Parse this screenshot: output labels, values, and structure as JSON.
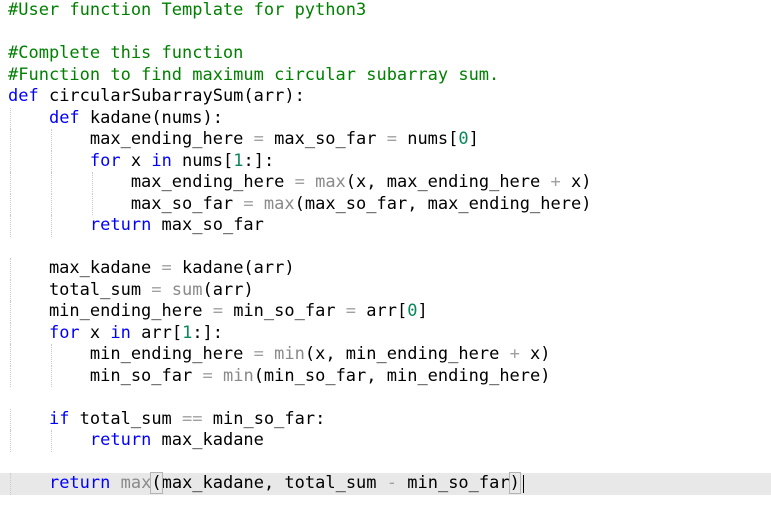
{
  "editor": {
    "language": "python3",
    "colors": {
      "comment": "#008000",
      "keyword": "#0000ff",
      "builtin": "#8a8a8a",
      "number": "#09885a",
      "operator": "#a0a0a0",
      "text": "#000000",
      "active_line": "#e8e8e8"
    },
    "lines": [
      [
        [
          "comment",
          "#User function Template for python3"
        ]
      ],
      [],
      [
        [
          "comment",
          "#Complete this function"
        ]
      ],
      [
        [
          "comment",
          "#Function to find maximum circular subarray sum."
        ]
      ],
      [
        [
          "kw",
          "def"
        ],
        [
          "name",
          " circularSubarraySum(arr):"
        ]
      ],
      [
        [
          "name",
          "    "
        ],
        [
          "kw",
          "def"
        ],
        [
          "name",
          " kadane(nums):"
        ]
      ],
      [
        [
          "name",
          "        max_ending_here "
        ],
        [
          "op",
          "="
        ],
        [
          "name",
          " max_so_far "
        ],
        [
          "op",
          "="
        ],
        [
          "name",
          " nums["
        ],
        [
          "num",
          "0"
        ],
        [
          "name",
          "]"
        ]
      ],
      [
        [
          "name",
          "        "
        ],
        [
          "kw",
          "for"
        ],
        [
          "name",
          " x "
        ],
        [
          "kw",
          "in"
        ],
        [
          "name",
          " nums["
        ],
        [
          "num",
          "1"
        ],
        [
          "name",
          ":]:"
        ]
      ],
      [
        [
          "name",
          "            max_ending_here "
        ],
        [
          "op",
          "="
        ],
        [
          "name",
          " "
        ],
        [
          "builtin",
          "max"
        ],
        [
          "name",
          "(x, max_ending_here "
        ],
        [
          "op",
          "+"
        ],
        [
          "name",
          " x)"
        ]
      ],
      [
        [
          "name",
          "            max_so_far "
        ],
        [
          "op",
          "="
        ],
        [
          "name",
          " "
        ],
        [
          "builtin",
          "max"
        ],
        [
          "name",
          "(max_so_far, max_ending_here)"
        ]
      ],
      [
        [
          "name",
          "        "
        ],
        [
          "kw",
          "return"
        ],
        [
          "name",
          " max_so_far"
        ]
      ],
      [],
      [
        [
          "name",
          "    max_kadane "
        ],
        [
          "op",
          "="
        ],
        [
          "name",
          " kadane(arr)"
        ]
      ],
      [
        [
          "name",
          "    total_sum "
        ],
        [
          "op",
          "="
        ],
        [
          "name",
          " "
        ],
        [
          "builtin",
          "sum"
        ],
        [
          "name",
          "(arr)"
        ]
      ],
      [
        [
          "name",
          "    min_ending_here "
        ],
        [
          "op",
          "="
        ],
        [
          "name",
          " min_so_far "
        ],
        [
          "op",
          "="
        ],
        [
          "name",
          " arr["
        ],
        [
          "num",
          "0"
        ],
        [
          "name",
          "]"
        ]
      ],
      [
        [
          "name",
          "    "
        ],
        [
          "kw",
          "for"
        ],
        [
          "name",
          " x "
        ],
        [
          "kw",
          "in"
        ],
        [
          "name",
          " arr["
        ],
        [
          "num",
          "1"
        ],
        [
          "name",
          ":]:"
        ]
      ],
      [
        [
          "name",
          "        min_ending_here "
        ],
        [
          "op",
          "="
        ],
        [
          "name",
          " "
        ],
        [
          "builtin",
          "min"
        ],
        [
          "name",
          "(x, min_ending_here "
        ],
        [
          "op",
          "+"
        ],
        [
          "name",
          " x)"
        ]
      ],
      [
        [
          "name",
          "        min_so_far "
        ],
        [
          "op",
          "="
        ],
        [
          "name",
          " "
        ],
        [
          "builtin",
          "min"
        ],
        [
          "name",
          "(min_so_far, min_ending_here)"
        ]
      ],
      [],
      [
        [
          "name",
          "    "
        ],
        [
          "kw",
          "if"
        ],
        [
          "name",
          " total_sum "
        ],
        [
          "op",
          "=="
        ],
        [
          "name",
          " min_so_far:"
        ]
      ],
      [
        [
          "name",
          "        "
        ],
        [
          "kw",
          "return"
        ],
        [
          "name",
          " max_kadane"
        ]
      ],
      [],
      [
        [
          "name",
          "    "
        ],
        [
          "kw",
          "return"
        ],
        [
          "name",
          " "
        ],
        [
          "builtin",
          "max"
        ],
        [
          "paren",
          "("
        ],
        [
          "name",
          "max_kadane, total_sum "
        ],
        [
          "op",
          "-"
        ],
        [
          "name",
          " min_so_far"
        ],
        [
          "paren",
          ")"
        ]
      ]
    ],
    "active_line_index": 22,
    "cursor_line_index": 22
  }
}
